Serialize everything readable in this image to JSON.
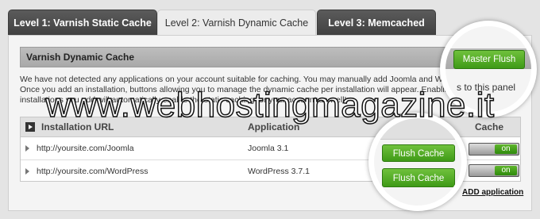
{
  "tabs": [
    {
      "label": "Level 1: Varnish Static Cache"
    },
    {
      "label": "Level 2: Varnish Dynamic Cache"
    },
    {
      "label": "Level 3: Memcached"
    }
  ],
  "panel": {
    "title": "Varnish Dynamic Cache",
    "master_flush_label": "Master Flush",
    "description_lines": [
      "We have not detected any applications on your account suitable for caching. You may manually add Joomla and Wordpress installa",
      "Once you add an installation, buttons allowing you to manage the dynamic cache per installation will appear. Enabling the Dynamic cach",
      "installations you add will automatically enable the static caching for your account as well!"
    ],
    "description_tail": "s to this panel"
  },
  "table": {
    "headers": {
      "url": "Installation URL",
      "application": "Application",
      "cache": "Cache"
    },
    "rows": [
      {
        "url": "http://yoursite.com/Joomla",
        "application": "Joomla 3.1",
        "flush_label": "Flush Cache",
        "toggle": "on"
      },
      {
        "url": "http://yoursite.com/WordPress",
        "application": "WordPress 3.7.1",
        "flush_label": "Flush Cache",
        "toggle": "on"
      }
    ]
  },
  "add_application_label": "ADD application",
  "watermark": "www.webhostingmagazine.it"
}
